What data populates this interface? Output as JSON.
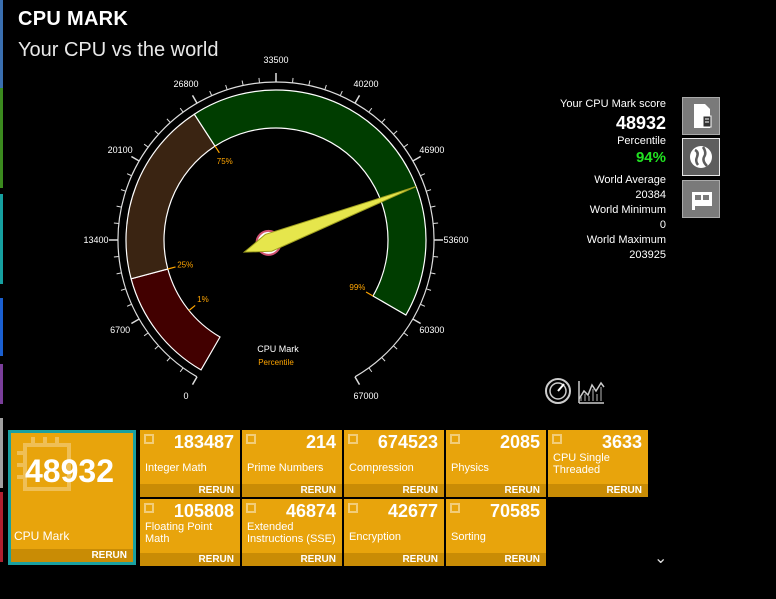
{
  "title": "CPU MARK",
  "subtitle": "Your CPU vs the world",
  "gauge": {
    "tick_labels": [
      "0",
      "6700",
      "13400",
      "20100",
      "26800",
      "33500",
      "40200",
      "46900",
      "53600",
      "60300",
      "67000"
    ],
    "percentile_marks": [
      "1%",
      "25%",
      "75%",
      "99%"
    ],
    "center_label": "CPU Mark",
    "center_sublabel": "Percentile",
    "min": 0,
    "max": 67000,
    "value": 48932
  },
  "stats": {
    "score_label": "Your CPU Mark score",
    "score": "48932",
    "percentile_label": "Percentile",
    "percentile": "94%",
    "avg_label": "World Average",
    "avg": "20384",
    "min_label": "World Minimum",
    "min": "0",
    "max_label": "World Maximum",
    "max": "203925"
  },
  "main_tile": {
    "value": "48932",
    "label": "CPU Mark",
    "rerun": "RERUN"
  },
  "tiles": [
    {
      "value": "183487",
      "label": "Integer Math",
      "rerun": "RERUN"
    },
    {
      "value": "214",
      "label": "Prime Numbers",
      "rerun": "RERUN"
    },
    {
      "value": "674523",
      "label": "Compression",
      "rerun": "RERUN"
    },
    {
      "value": "2085",
      "label": "Physics",
      "rerun": "RERUN"
    },
    {
      "value": "3633",
      "label": "CPU Single Threaded",
      "rerun": "RERUN"
    },
    {
      "value": "105808",
      "label": "Floating Point Math",
      "rerun": "RERUN"
    },
    {
      "value": "46874",
      "label": "Extended Instructions (SSE)",
      "rerun": "RERUN"
    },
    {
      "value": "42677",
      "label": "Encryption",
      "rerun": "RERUN"
    },
    {
      "value": "70585",
      "label": "Sorting",
      "rerun": "RERUN"
    }
  ],
  "colors": {
    "tile": "#e8a40c",
    "accent": "#1aa0a0",
    "gauge_green": "#003d00",
    "gauge_brown": "#3a2412",
    "gauge_red": "#420000"
  }
}
